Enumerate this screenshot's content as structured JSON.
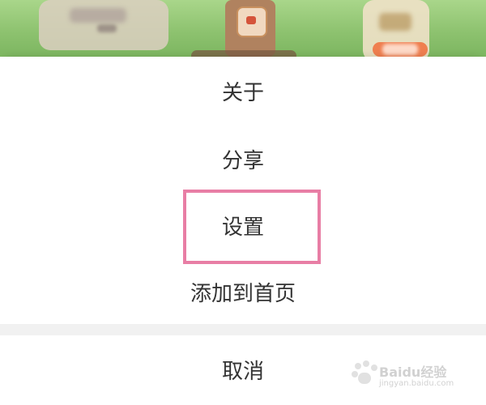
{
  "background": {
    "scene": "game-scene-blurred"
  },
  "sheet": {
    "items": [
      {
        "label": "关于"
      },
      {
        "label": "分享"
      },
      {
        "label": "设置"
      },
      {
        "label": "添加到首页"
      }
    ],
    "cancel": {
      "label": "取消"
    },
    "highlighted_item": "设置",
    "highlight_color": "#e87ea5"
  },
  "watermark": {
    "brand": "Baidu经验",
    "url": "jingyan.baidu.com"
  }
}
